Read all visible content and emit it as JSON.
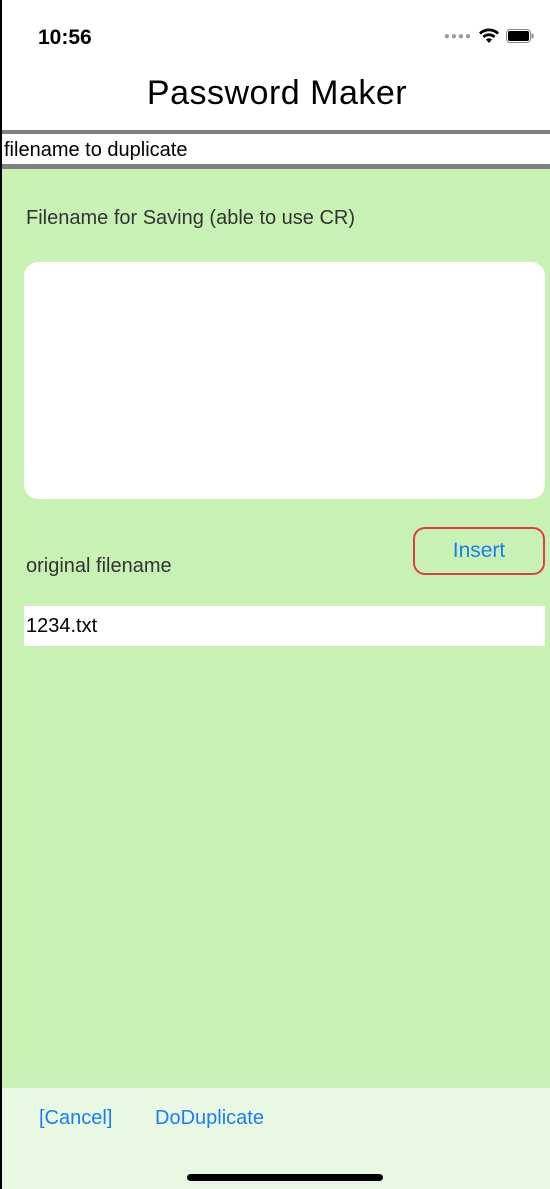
{
  "status_bar": {
    "time": "10:56",
    "signal_icon": "signal-dots-icon",
    "wifi_icon": "wifi-icon",
    "battery_icon": "battery-icon"
  },
  "nav": {
    "title": "Password Maker"
  },
  "header": {
    "label": "filename to duplicate"
  },
  "form": {
    "save_label": "Filename for Saving (able to use CR)",
    "save_value": "",
    "insert_label": "Insert",
    "original_label": "original filename",
    "original_value": "1234.txt"
  },
  "toolbar": {
    "cancel_label": "[Cancel]",
    "duplicate_label": "DoDuplicate"
  },
  "colors": {
    "background_green": "#c8f2b4",
    "toolbar_green": "#e9f8e2",
    "link_blue": "#1a7ef0",
    "insert_border_red": "#e23b4a",
    "rule_gray": "#808080"
  }
}
